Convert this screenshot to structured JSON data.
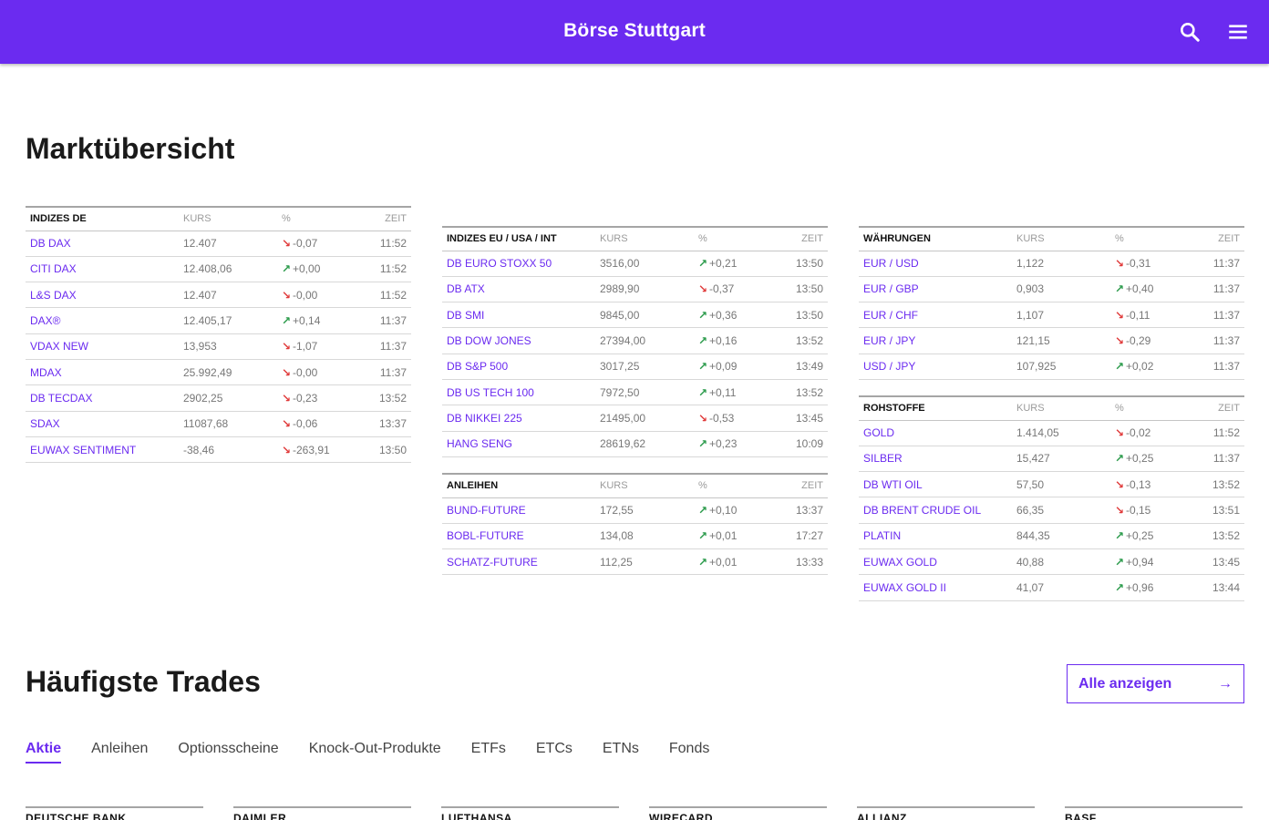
{
  "header": {
    "brand": "Börse Stuttgart",
    "search_icon": "search-icon",
    "menu_icon": "hamburger-menu-icon",
    "accent_color": "#6b2bf0"
  },
  "market": {
    "title": "Marktübersicht",
    "col_kurs": "KURS",
    "col_pct": "%",
    "col_zeit": "ZEIT",
    "tables": {
      "de": {
        "heading": "INDIZES DE",
        "rows": [
          {
            "name": "DB DAX",
            "kurs": "12.407",
            "dir": "down",
            "pct": "-0,07",
            "zeit": "11:52"
          },
          {
            "name": "CITI DAX",
            "kurs": "12.408,06",
            "dir": "up",
            "pct": "+0,00",
            "zeit": "11:52"
          },
          {
            "name": "L&S DAX",
            "kurs": "12.407",
            "dir": "down",
            "pct": "-0,00",
            "zeit": "11:52"
          },
          {
            "name": "DAX®",
            "kurs": "12.405,17",
            "dir": "up",
            "pct": "+0,14",
            "zeit": "11:37"
          },
          {
            "name": "VDAX NEW",
            "kurs": "13,953",
            "dir": "down",
            "pct": "-1,07",
            "zeit": "11:37"
          },
          {
            "name": "MDAX",
            "kurs": "25.992,49",
            "dir": "down",
            "pct": "-0,00",
            "zeit": "11:37"
          },
          {
            "name": "DB TECDAX",
            "kurs": "2902,25",
            "dir": "down",
            "pct": "-0,23",
            "zeit": "13:52"
          },
          {
            "name": "SDAX",
            "kurs": "11087,68",
            "dir": "down",
            "pct": "-0,06",
            "zeit": "13:37"
          },
          {
            "name": "EUWAX SENTIMENT",
            "kurs": "-38,46",
            "dir": "down",
            "pct": "-263,91",
            "zeit": "13:50"
          }
        ]
      },
      "eu": {
        "heading": "INDIZES EU / USA / INT",
        "rows": [
          {
            "name": "DB EURO STOXX 50",
            "kurs": "3516,00",
            "dir": "up",
            "pct": "+0,21",
            "zeit": "13:50"
          },
          {
            "name": "DB ATX",
            "kurs": "2989,90",
            "dir": "down",
            "pct": "-0,37",
            "zeit": "13:50"
          },
          {
            "name": "DB SMI",
            "kurs": "9845,00",
            "dir": "up",
            "pct": "+0,36",
            "zeit": "13:50"
          },
          {
            "name": "DB DOW JONES",
            "kurs": "27394,00",
            "dir": "up",
            "pct": "+0,16",
            "zeit": "13:52"
          },
          {
            "name": "DB S&P 500",
            "kurs": "3017,25",
            "dir": "up",
            "pct": "+0,09",
            "zeit": "13:49"
          },
          {
            "name": "DB US TECH 100",
            "kurs": "7972,50",
            "dir": "up",
            "pct": "+0,11",
            "zeit": "13:52"
          },
          {
            "name": "DB NIKKEI 225",
            "kurs": "21495,00",
            "dir": "down",
            "pct": "-0,53",
            "zeit": "13:45"
          },
          {
            "name": "HANG SENG",
            "kurs": "28619,62",
            "dir": "up",
            "pct": "+0,23",
            "zeit": "10:09"
          }
        ]
      },
      "anleihen": {
        "heading": "ANLEIHEN",
        "rows": [
          {
            "name": "BUND-FUTURE",
            "kurs": "172,55",
            "dir": "up",
            "pct": "+0,10",
            "zeit": "13:37"
          },
          {
            "name": "BOBL-FUTURE",
            "kurs": "134,08",
            "dir": "up",
            "pct": "+0,01",
            "zeit": "17:27"
          },
          {
            "name": "SCHATZ-FUTURE",
            "kurs": "112,25",
            "dir": "up",
            "pct": "+0,01",
            "zeit": "13:33"
          }
        ]
      },
      "fx": {
        "heading": "WÄHRUNGEN",
        "rows": [
          {
            "name": "EUR / USD",
            "kurs": "1,122",
            "dir": "down",
            "pct": "-0,31",
            "zeit": "11:37"
          },
          {
            "name": "EUR / GBP",
            "kurs": "0,903",
            "dir": "up",
            "pct": "+0,40",
            "zeit": "11:37"
          },
          {
            "name": "EUR / CHF",
            "kurs": "1,107",
            "dir": "down",
            "pct": "-0,11",
            "zeit": "11:37"
          },
          {
            "name": "EUR / JPY",
            "kurs": "121,15",
            "dir": "down",
            "pct": "-0,29",
            "zeit": "11:37"
          },
          {
            "name": "USD / JPY",
            "kurs": "107,925",
            "dir": "up",
            "pct": "+0,02",
            "zeit": "11:37"
          }
        ]
      },
      "rohstoffe": {
        "heading": "ROHSTOFFE",
        "rows": [
          {
            "name": "GOLD",
            "kurs": "1.414,05",
            "dir": "down",
            "pct": "-0,02",
            "zeit": "11:52"
          },
          {
            "name": "SILBER",
            "kurs": "15,427",
            "dir": "up",
            "pct": "+0,25",
            "zeit": "11:37"
          },
          {
            "name": "DB WTI OIL",
            "kurs": "57,50",
            "dir": "down",
            "pct": "-0,13",
            "zeit": "13:52"
          },
          {
            "name": "DB BRENT CRUDE OIL",
            "kurs": "66,35",
            "dir": "down",
            "pct": "-0,15",
            "zeit": "13:51"
          },
          {
            "name": "PLATIN",
            "kurs": "844,35",
            "dir": "up",
            "pct": "+0,25",
            "zeit": "13:52"
          },
          {
            "name": "EUWAX GOLD",
            "kurs": "40,88",
            "dir": "up",
            "pct": "+0,94",
            "zeit": "13:45"
          },
          {
            "name": "EUWAX GOLD II",
            "kurs": "41,07",
            "dir": "up",
            "pct": "+0,96",
            "zeit": "13:44"
          }
        ]
      }
    }
  },
  "trades": {
    "title": "Häufigste Trades",
    "all_button": "Alle anzeigen",
    "tabs": [
      "Aktie",
      "Anleihen",
      "Optionsscheine",
      "Knock-Out-Produkte",
      "ETFs",
      "ETCs",
      "ETNs",
      "Fonds"
    ],
    "active_tab": "Aktie",
    "cards": [
      "DEUTSCHE BANK",
      "DAIMLER",
      "LUFTHANSA",
      "WIRECARD",
      "ALLIANZ",
      "BASF"
    ]
  }
}
